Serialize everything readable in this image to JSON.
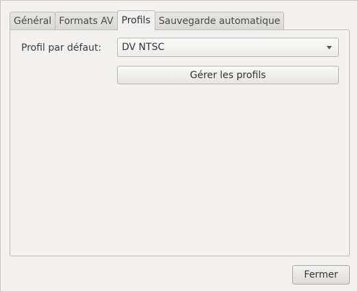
{
  "tabs": [
    {
      "label": "Général",
      "active": false
    },
    {
      "label": "Formats AV",
      "active": false
    },
    {
      "label": "Profils",
      "active": true
    },
    {
      "label": "Sauvegarde automatique",
      "active": false
    }
  ],
  "profiles": {
    "default_label": "Profil par défaut:",
    "default_value": "DV NTSC",
    "manage_button": "Gérer les profils"
  },
  "footer": {
    "close_button": "Fermer"
  },
  "icons": {
    "dropdown": "chevron-down-icon"
  }
}
